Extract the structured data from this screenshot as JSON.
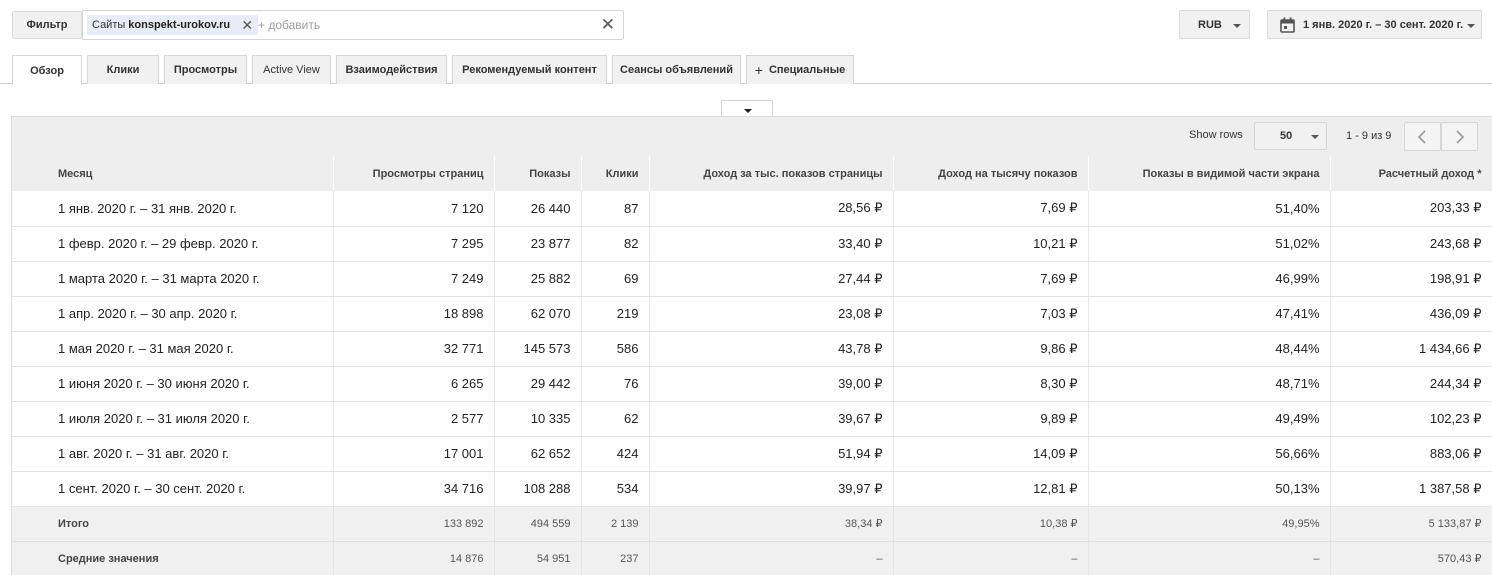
{
  "filter": {
    "button_label": "Фильтр",
    "chip_prefix": "Сайты",
    "chip_value": "konspekt-urokov.ru",
    "add_placeholder": "+ добавить"
  },
  "currency": {
    "label": "RUB"
  },
  "date_range": {
    "label": "1 янв. 2020 г. – 30 сент. 2020 г."
  },
  "tabs": [
    {
      "label": "Обзор"
    },
    {
      "label": "Клики"
    },
    {
      "label": "Просмотры"
    },
    {
      "label": "Active View"
    },
    {
      "label": "Взаимодействия"
    },
    {
      "label": "Рекомендуемый контент"
    },
    {
      "label": "Сеансы объявлений"
    },
    {
      "label": "Специальные"
    }
  ],
  "pagination": {
    "show_rows_label": "Show rows",
    "rows_value": "50",
    "info": "1 - 9 из 9"
  },
  "table": {
    "headers": [
      "Месяц",
      "Просмотры страниц",
      "Показы",
      "Клики",
      "Доход за тыс. показов страницы",
      "Доход на тысячу показов",
      "Показы в видимой части экрана",
      "Расчетный доход *"
    ],
    "rows": [
      [
        "1 янв. 2020 г. – 31 янв. 2020 г.",
        "7 120",
        "26 440",
        "87",
        "28,56 ₽",
        "7,69 ₽",
        "51,40%",
        "203,33 ₽"
      ],
      [
        "1 февр. 2020 г. – 29 февр. 2020 г.",
        "7 295",
        "23 877",
        "82",
        "33,40 ₽",
        "10,21 ₽",
        "51,02%",
        "243,68 ₽"
      ],
      [
        "1 марта 2020 г. – 31 марта 2020 г.",
        "7 249",
        "25 882",
        "69",
        "27,44 ₽",
        "7,69 ₽",
        "46,99%",
        "198,91 ₽"
      ],
      [
        "1 апр. 2020 г. – 30 апр. 2020 г.",
        "18 898",
        "62 070",
        "219",
        "23,08 ₽",
        "7,03 ₽",
        "47,41%",
        "436,09 ₽"
      ],
      [
        "1 мая 2020 г. – 31 мая 2020 г.",
        "32 771",
        "145 573",
        "586",
        "43,78 ₽",
        "9,86 ₽",
        "48,44%",
        "1 434,66 ₽"
      ],
      [
        "1 июня 2020 г. – 30 июня 2020 г.",
        "6 265",
        "29 442",
        "76",
        "39,00 ₽",
        "8,30 ₽",
        "48,71%",
        "244,34 ₽"
      ],
      [
        "1 июля 2020 г. – 31 июля 2020 г.",
        "2 577",
        "10 335",
        "62",
        "39,67 ₽",
        "9,89 ₽",
        "49,49%",
        "102,23 ₽"
      ],
      [
        "1 авг. 2020 г. – 31 авг. 2020 г.",
        "17 001",
        "62 652",
        "424",
        "51,94 ₽",
        "14,09 ₽",
        "56,66%",
        "883,06 ₽"
      ],
      [
        "1 сент. 2020 г. – 30 сент. 2020 г.",
        "34 716",
        "108 288",
        "534",
        "39,97 ₽",
        "12,81 ₽",
        "50,13%",
        "1 387,58 ₽"
      ]
    ],
    "summary_rows": [
      [
        "Итого",
        "133 892",
        "494 559",
        "2 139",
        "38,34 ₽",
        "10,38 ₽",
        "49,95%",
        "5 133,87 ₽"
      ],
      [
        "Средние значения",
        "14 876",
        "54 951",
        "237",
        "–",
        "–",
        "–",
        "570,43 ₽"
      ]
    ]
  }
}
